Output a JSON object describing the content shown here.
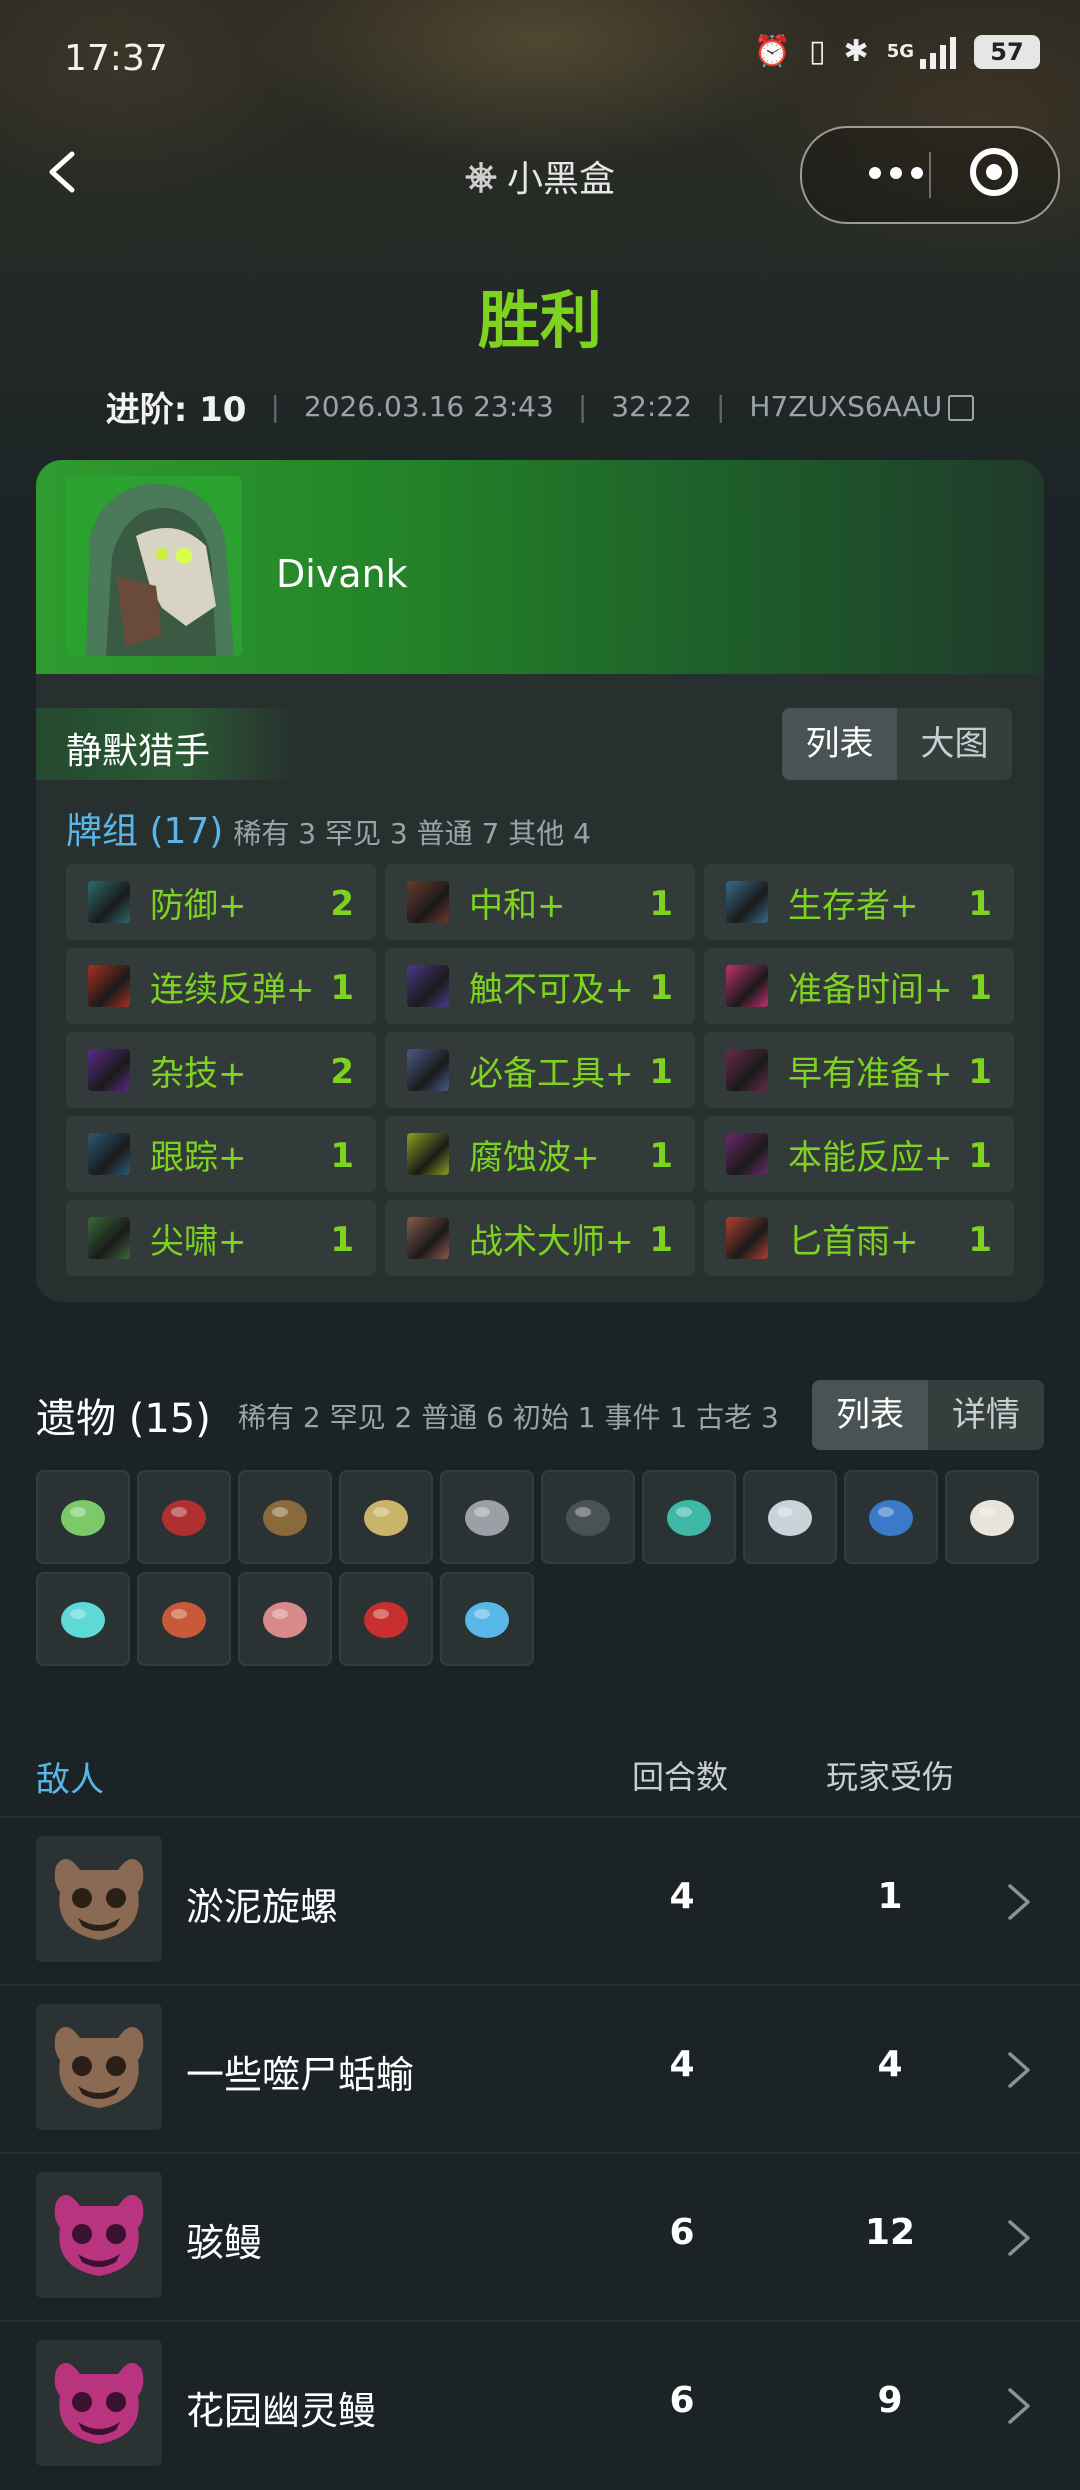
{
  "status_bar": {
    "time": "17:37",
    "network": "5G",
    "battery": "57"
  },
  "nav": {
    "brand": "小黑盒"
  },
  "result": {
    "title": "胜利",
    "ascension_label": "进阶: 10",
    "datetime": "2026.03.16 23:43",
    "duration": "32:22",
    "seed": "H7ZUXS6AAU"
  },
  "player": {
    "name": "Divank"
  },
  "deck": {
    "title": "静默猎手",
    "view_tabs": [
      "列表",
      "大图"
    ],
    "count_label": "牌组 (17)",
    "rarity_summary": "稀有 3  罕见 3  普通 7  其他 4",
    "cards": [
      {
        "name": "防御+",
        "qty": "2",
        "color": "#2b6b6e"
      },
      {
        "name": "中和+",
        "qty": "1",
        "color": "#6a3a2a"
      },
      {
        "name": "生存者+",
        "qty": "1",
        "color": "#3a6a8a"
      },
      {
        "name": "连续反弹+",
        "qty": "1",
        "color": "#a83020"
      },
      {
        "name": "触不可及+",
        "qty": "1",
        "color": "#4a3a8a"
      },
      {
        "name": "准备时间+",
        "qty": "1",
        "color": "#c03070"
      },
      {
        "name": "杂技+",
        "qty": "2",
        "color": "#5a2a8a"
      },
      {
        "name": "必备工具+",
        "qty": "1",
        "color": "#4a5a8a"
      },
      {
        "name": "早有准备+",
        "qty": "1",
        "color": "#6a2a4a"
      },
      {
        "name": "跟踪+",
        "qty": "1",
        "color": "#2a5a7a"
      },
      {
        "name": "腐蚀波+",
        "qty": "1",
        "color": "#8aa020"
      },
      {
        "name": "本能反应+",
        "qty": "1",
        "color": "#6a2a6a"
      },
      {
        "name": "尖啸+",
        "qty": "1",
        "color": "#3a6a3a"
      },
      {
        "name": "战术大师+",
        "qty": "1",
        "color": "#8a5a4a"
      },
      {
        "name": "匕首雨+",
        "qty": "1",
        "color": "#b04030"
      }
    ]
  },
  "relics": {
    "title": "遗物 (15)",
    "rarity_summary": "稀有 2  罕见 2  普通 6  初始 1  事件 1  古老 3",
    "view_tabs": [
      "列表",
      "详情"
    ],
    "items": [
      {
        "icon": "eye-orb-icon",
        "color": "#7cc96a"
      },
      {
        "icon": "scissors-icon",
        "color": "#b03030"
      },
      {
        "icon": "coin-pouch-icon",
        "color": "#8a6a3a"
      },
      {
        "icon": "newtons-cradle-icon",
        "color": "#c9b46a"
      },
      {
        "icon": "kunai-icon",
        "color": "#9aa0a6"
      },
      {
        "icon": "chest-icon",
        "color": "#4a5254"
      },
      {
        "icon": "bowl-icon",
        "color": "#3fb8a8"
      },
      {
        "icon": "stone-icon",
        "color": "#c8d4da"
      },
      {
        "icon": "anchor-icon",
        "color": "#3a7ac8"
      },
      {
        "icon": "skull-icon",
        "color": "#e8e4dc"
      },
      {
        "icon": "gem-icon",
        "color": "#5fd8d8"
      },
      {
        "icon": "mask-icon",
        "color": "#c85a3a"
      },
      {
        "icon": "meat-icon",
        "color": "#d88a8a"
      },
      {
        "icon": "potion-icon",
        "color": "#c83030"
      },
      {
        "icon": "fish-icon",
        "color": "#5ab8e8"
      }
    ]
  },
  "enemies": {
    "header": {
      "label": "敌人",
      "turns": "回合数",
      "damage": "玩家受伤"
    },
    "rows": [
      {
        "name": "淤泥旋螺",
        "turns": "4",
        "damage": "1",
        "type": "normal"
      },
      {
        "name": "一些噬尸蛞蝓",
        "turns": "4",
        "damage": "4",
        "type": "normal"
      },
      {
        "name": "骇鳗",
        "turns": "6",
        "damage": "12",
        "type": "elite"
      },
      {
        "name": "花园幽灵鳗",
        "turns": "6",
        "damage": "9",
        "type": "elite"
      }
    ]
  }
}
